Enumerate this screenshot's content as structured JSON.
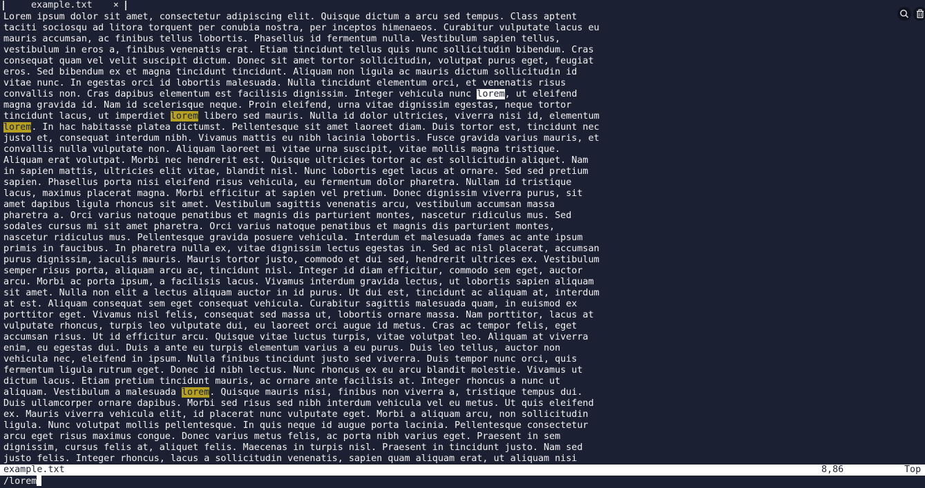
{
  "tab": {
    "title": "example.txt",
    "close_glyph": "×"
  },
  "toolbar": {
    "search_icon": "search-icon",
    "trash_icon": "trash-icon"
  },
  "colors": {
    "background": "#1b2032",
    "match_highlight": "#b5a021",
    "current_match": "#ffffff"
  },
  "editor": {
    "lines": [
      [
        {
          "t": "Lorem ipsum dolor sit amet, consectetur adipiscing elit. Quisque dictum a arcu sed tempus. Class aptent"
        }
      ],
      [
        {
          "t": "taciti sociosqu ad litora torquent per conubia nostra, per inceptos himenaeos. Curabitur vulputate lacus eu"
        }
      ],
      [
        {
          "t": "mauris accumsan, ac finibus tellus lobortis. Phasellus id fermentum nulla. Vestibulum sapien tellus,"
        }
      ],
      [
        {
          "t": "vestibulum in eros a, finibus venenatis erat. Etiam tincidunt tellus quis nunc sollicitudin bibendum. Cras"
        }
      ],
      [
        {
          "t": "consequat quam vel velit suscipit dictum. Donec sit amet tortor sollicitudin, volutpat purus eget, feugiat"
        }
      ],
      [
        {
          "t": "eros. Sed bibendum ex et magna tincidunt tincidunt. Aliquam non ligula ac mauris dictum sollicitudin id"
        }
      ],
      [
        {
          "t": "vitae nunc. In egestas orci id lobortis malesuada. Nulla tincidunt elementum orci, et venenatis risus"
        }
      ],
      [
        {
          "t": "convallis non. Cras dapibus elementum est facilisis dignissim. Integer vehicula nunc "
        },
        {
          "t": "lorem",
          "h": "cur"
        },
        {
          "t": ", ut eleifend"
        }
      ],
      [
        {
          "t": "magna gravida id. Nam id scelerisque neque. Proin eleifend, urna vitae dignissim egestas, neque tortor"
        }
      ],
      [
        {
          "t": "tincidunt lacus, ut imperdiet "
        },
        {
          "t": "lorem",
          "h": "hl"
        },
        {
          "t": " libero sed mauris. Nulla id dolor ultricies, viverra nisi id, elementum"
        }
      ],
      [
        {
          "t": "lorem",
          "h": "hl"
        },
        {
          "t": ". In hac habitasse platea dictumst. Pellentesque sit amet laoreet diam. Duis tortor est, tincidunt nec"
        }
      ],
      [
        {
          "t": "justo et, consequat interdum nibh. Vivamus mattis eu nibh lacinia lobortis. Fusce gravida varius mauris, et"
        }
      ],
      [
        {
          "t": "convallis nulla vulputate non. Aliquam laoreet mi vitae urna suscipit, vitae mollis magna tristique."
        }
      ],
      [
        {
          "t": "Aliquam erat volutpat. Morbi nec hendrerit est. Quisque ultricies tortor ac est sollicitudin aliquet. Nam"
        }
      ],
      [
        {
          "t": "in sapien mattis, ultricies elit vitae, blandit nisl. Nunc lobortis eget lacus at ornare. Sed sed pretium"
        }
      ],
      [
        {
          "t": "sapien. Phasellus porta nisi eleifend risus vehicula, eu fermentum dolor pharetra. Nullam id tristique"
        }
      ],
      [
        {
          "t": "lacus, maximus placerat magna. Morbi efficitur at sapien vel pretium. Donec dignissim viverra purus, sit"
        }
      ],
      [
        {
          "t": "amet dapibus ligula rhoncus sit amet. Vestibulum sagittis venenatis arcu, vestibulum accumsan massa"
        }
      ],
      [
        {
          "t": "pharetra a. Orci varius natoque penatibus et magnis dis parturient montes, nascetur ridiculus mus. Sed"
        }
      ],
      [
        {
          "t": "sodales cursus mi sit amet pharetra. Orci varius natoque penatibus et magnis dis parturient montes,"
        }
      ],
      [
        {
          "t": "nascetur ridiculus mus. Pellentesque gravida posuere vehicula. Interdum et malesuada fames ac ante ipsum"
        }
      ],
      [
        {
          "t": "primis in faucibus. In pharetra nulla ex, vitae dignissim lectus egestas in. Sed ac nisl placerat, accumsan"
        }
      ],
      [
        {
          "t": "purus dignissim, iaculis mauris. Mauris tortor justo, commodo et dui sed, hendrerit ultrices ex. Vestibulum"
        }
      ],
      [
        {
          "t": "semper risus porta, aliquam arcu ac, tincidunt nisl. Integer id diam efficitur, commodo sem eget, auctor"
        }
      ],
      [
        {
          "t": "arcu. Morbi ac porta ipsum, a facilisis lacus. Vivamus interdum gravida lectus, ut lobortis sapien aliquam"
        }
      ],
      [
        {
          "t": "sit amet. Nulla non elit a lectus aliquam auctor in id purus. Ut dui est, tincidunt ac aliquam at, interdum"
        }
      ],
      [
        {
          "t": "at est. Aliquam consequat sem eget consequat vehicula. Curabitur sagittis malesuada quam, in euismod ex"
        }
      ],
      [
        {
          "t": "porttitor eget. Vivamus nisl felis, consequat sed massa ut, lobortis ornare massa. Nam porttitor, lacus at"
        }
      ],
      [
        {
          "t": "vulputate rhoncus, turpis leo vulputate dui, eu laoreet orci augue id metus. Cras ac tempor felis, eget"
        }
      ],
      [
        {
          "t": "accumsan risus. Ut id efficitur arcu. Quisque vitae luctus turpis, vitae volutpat leo. Aliquam at viverra"
        }
      ],
      [
        {
          "t": "enim, eu egestas dui. Duis a ante eu turpis elementum varius a eu purus. Duis leo tellus, auctor non"
        }
      ],
      [
        {
          "t": "vehicula nec, eleifend in ipsum. Nulla finibus tincidunt justo sed viverra. Duis tempor nunc orci, quis"
        }
      ],
      [
        {
          "t": "fermentum ligula rutrum eget. Donec id nibh lectus. Nunc rhoncus ex eu arcu blandit molestie. Vivamus ut"
        }
      ],
      [
        {
          "t": "dictum lacus. Etiam pretium tincidunt mauris, ac ornare ante facilisis at. Integer rhoncus a nunc ut"
        }
      ],
      [
        {
          "t": "aliquam. Vestibulum a malesuada "
        },
        {
          "t": "lorem",
          "h": "hl"
        },
        {
          "t": ". Quisque mauris nisi, finibus non viverra a, tristique tempus dui."
        }
      ],
      [
        {
          "t": "Duis ullamcorper ornare dapibus. Morbi sed risus sed nibh interdum vehicula vel eu metus. Ut quis eleifend"
        }
      ],
      [
        {
          "t": "ex. Mauris viverra vehicula elit, id placerat nunc vulputate eget. Morbi a aliquam arcu, non sollicitudin"
        }
      ],
      [
        {
          "t": "ligula. Nunc volutpat mollis pellentesque. In quis neque id augue porta lacinia. Pellentesque consectetur"
        }
      ],
      [
        {
          "t": "arcu eget risus maximus congue. Donec varius metus felis, ac porta nibh varius eget. Praesent in sem"
        }
      ],
      [
        {
          "t": "dignissim, cursus felis at, aliquet felis. Maecenas in turpis nisl. Praesent in tincidunt justo. Nam sed"
        }
      ],
      [
        {
          "t": "justo felis. Integer rhoncus, lacus a sollicitudin venenatis, sapien quam aliquam erat, ut aliquam nisi"
        }
      ]
    ]
  },
  "statusbar": {
    "filename": "example.txt",
    "position": "8,86",
    "scroll": "Top"
  },
  "cmdline": {
    "text": "/lorem"
  }
}
